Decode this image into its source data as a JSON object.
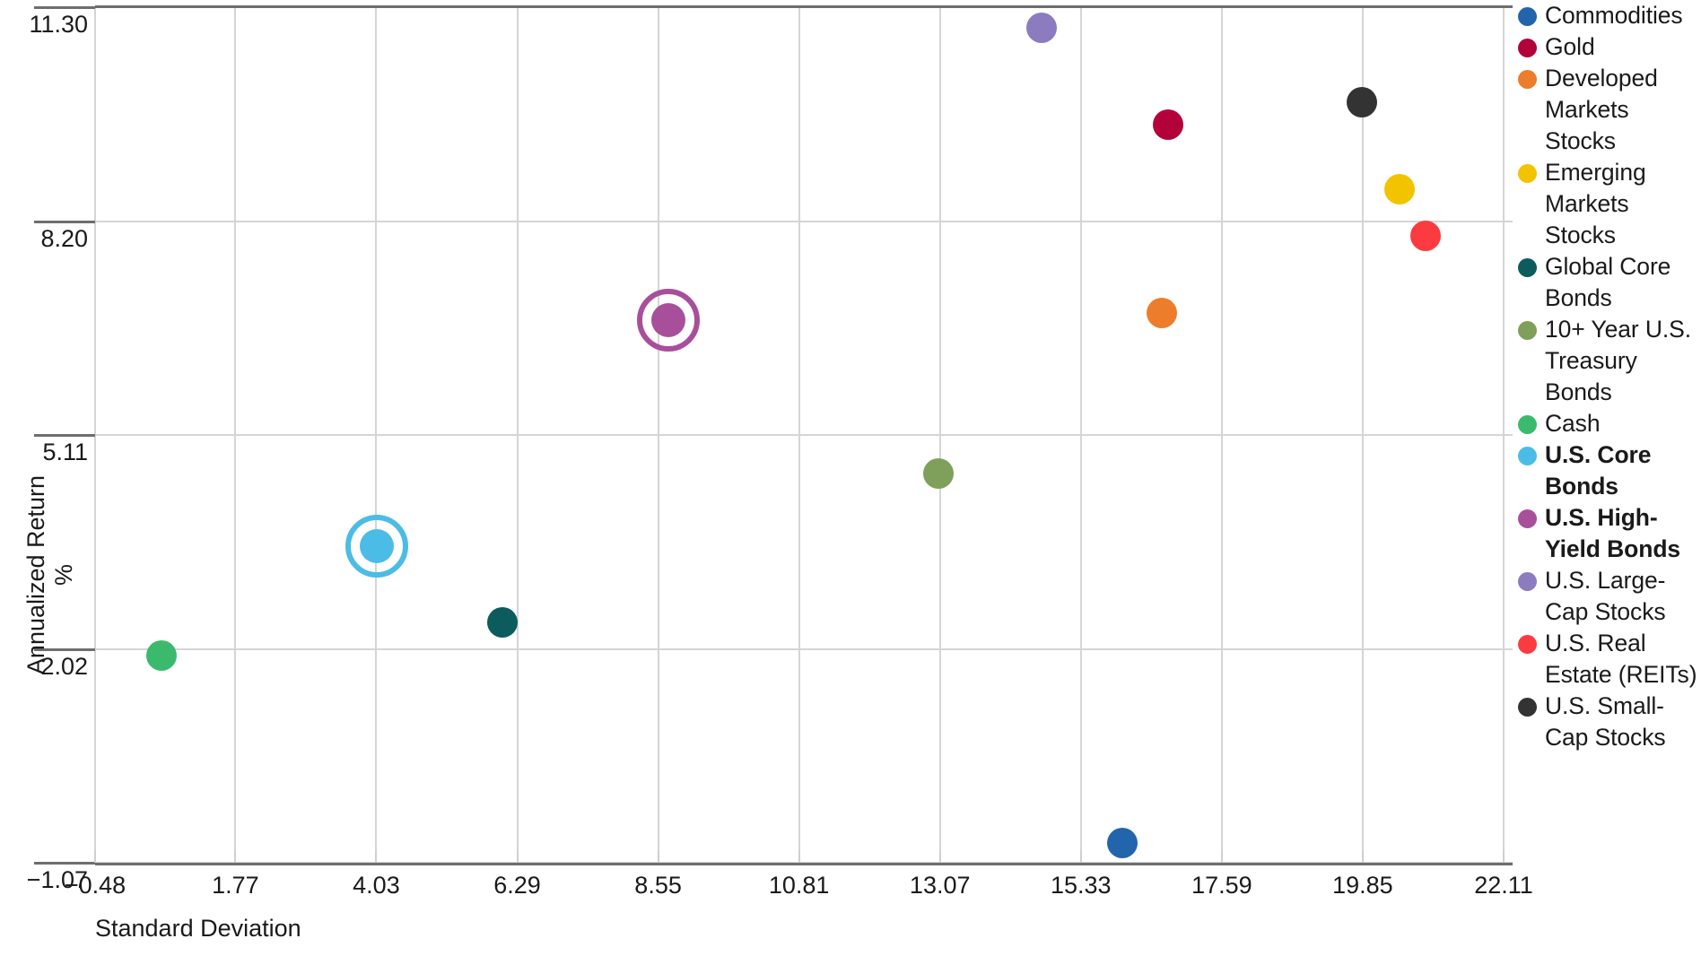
{
  "chart_data": {
    "type": "scatter",
    "title": "",
    "xlabel": "Standard Deviation",
    "ylabel": "Annualized Return %",
    "xticks": [
      "−0.48",
      "1.77",
      "4.03",
      "6.29",
      "8.55",
      "10.81",
      "13.07",
      "15.33",
      "17.59",
      "19.85",
      "22.11"
    ],
    "xtick_values": [
      -0.48,
      1.77,
      4.03,
      6.29,
      8.55,
      10.81,
      13.07,
      15.33,
      17.59,
      19.85,
      22.11
    ],
    "yticks": [
      "11.30",
      "8.20",
      "5.11",
      "2.02",
      "−1.07"
    ],
    "ytick_values": [
      11.3,
      8.2,
      5.11,
      2.02,
      -1.07
    ],
    "xlim": [
      -0.48,
      22.11
    ],
    "ylim": [
      -1.07,
      11.3
    ],
    "grid": true,
    "legend_position": "right",
    "points": [
      {
        "name": "Commodities",
        "x": 16.0,
        "y": -0.78,
        "color": "#2265AC",
        "highlight": false
      },
      {
        "name": "Gold",
        "x": 16.73,
        "y": 9.6,
        "color": "#B3023A",
        "highlight": false
      },
      {
        "name": "Developed Markets Stocks",
        "x": 16.63,
        "y": 6.88,
        "color": "#ED7D2B",
        "highlight": false
      },
      {
        "name": "Emerging Markets Stocks",
        "x": 20.44,
        "y": 8.67,
        "color": "#F4C300",
        "highlight": false
      },
      {
        "name": "Global Core Bonds",
        "x": 6.05,
        "y": 2.41,
        "color": "#0C5C5E",
        "highlight": false
      },
      {
        "name": "10+ Year U.S. Treasury Bonds",
        "x": 13.05,
        "y": 4.56,
        "color": "#7FA05A",
        "highlight": false
      },
      {
        "name": "Cash",
        "x": 0.59,
        "y": 1.93,
        "color": "#3BBA6D",
        "highlight": false
      },
      {
        "name": "U.S. Core Bonds",
        "x": 4.04,
        "y": 3.51,
        "color": "#4BBCE5",
        "highlight": true
      },
      {
        "name": "U.S. High-Yield Bonds",
        "x": 8.72,
        "y": 6.77,
        "color": "#A84F9C",
        "highlight": true
      },
      {
        "name": "U.S. Large-Cap Stocks",
        "x": 14.7,
        "y": 11.0,
        "color": "#8D7BBF",
        "highlight": false
      },
      {
        "name": "U.S. Real Estate (REITs)",
        "x": 20.86,
        "y": 8.0,
        "color": "#FC3B41",
        "highlight": false
      },
      {
        "name": "U.S. Small-Cap Stocks",
        "x": 19.84,
        "y": 9.93,
        "color": "#333333",
        "highlight": false
      }
    ]
  },
  "legend": {
    "items": [
      {
        "label": "Commodities",
        "color": "#2265AC",
        "bold": false
      },
      {
        "label": "Gold",
        "color": "#B3023A",
        "bold": false
      },
      {
        "label": "Developed Markets Stocks",
        "color": "#ED7D2B",
        "bold": false
      },
      {
        "label": "Emerging Markets Stocks",
        "color": "#F4C300",
        "bold": false
      },
      {
        "label": "Global Core Bonds",
        "color": "#0C5C5E",
        "bold": false
      },
      {
        "label": "10+ Year U.S. Treasury Bonds",
        "color": "#7FA05A",
        "bold": false
      },
      {
        "label": "Cash",
        "color": "#3BBA6D",
        "bold": false
      },
      {
        "label": "U.S. Core Bonds",
        "color": "#4BBCE5",
        "bold": true
      },
      {
        "label": "U.S. High-Yield Bonds",
        "color": "#A84F9C",
        "bold": true
      },
      {
        "label": "U.S. Large-Cap Stocks",
        "color": "#8D7BBF",
        "bold": false
      },
      {
        "label": "U.S. Real Estate (REITs)",
        "color": "#FC3B41",
        "bold": false
      },
      {
        "label": "U.S. Small-Cap Stocks",
        "color": "#333333",
        "bold": false
      }
    ]
  },
  "axes": {
    "x_title": "Standard Deviation",
    "y_title": "Annualized Return %"
  },
  "colors": {
    "grid": "#d5d5d5",
    "axis": "#6e6e6e",
    "text": "#1a1a1a",
    "background": "#ffffff"
  }
}
